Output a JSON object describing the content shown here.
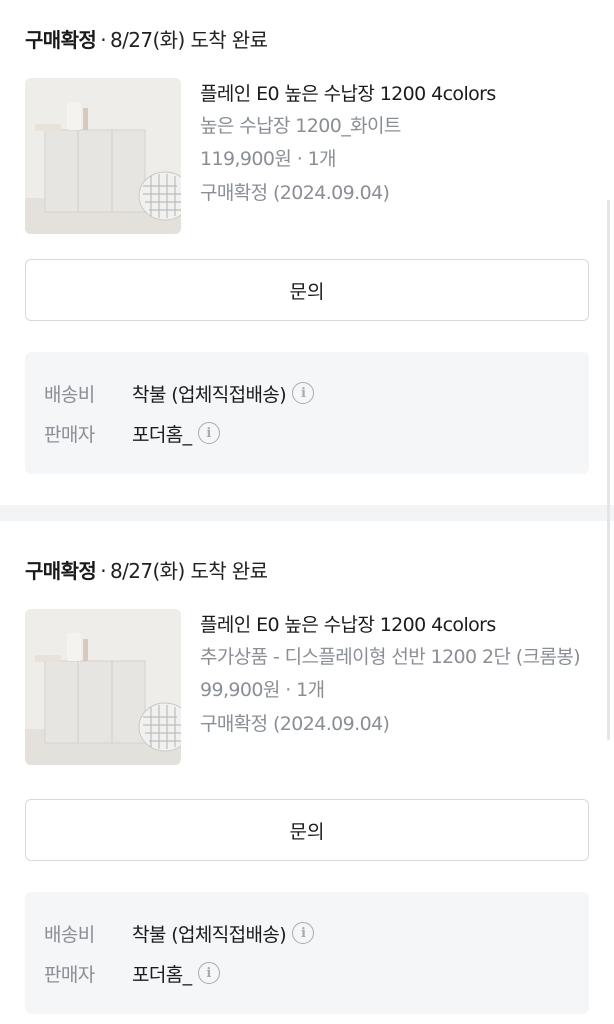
{
  "orders": [
    {
      "status": "구매확정",
      "separator": "·",
      "date_text": "8/27(화) 도착 완료",
      "product_name": "플레인 E0 높은 수납장 1200 4colors",
      "option": "높은 수납장 1200_화이트",
      "price_qty": "119,900원 · 1개",
      "confirm_date": "구매확정 (2024.09.04)",
      "inquiry_label": "문의",
      "delivery_fee_label": "배송비",
      "delivery_fee_value": "착불 (업체직접배송)",
      "seller_label": "판매자",
      "seller_value": "포더홈_"
    },
    {
      "status": "구매확정",
      "separator": "·",
      "date_text": "8/27(화) 도착 완료",
      "product_name": "플레인 E0 높은 수납장 1200 4colors",
      "option": "추가상품 - 디스플레이형 선반 1200 2단 (크롬봉)",
      "price_qty": "99,900원 · 1개",
      "confirm_date": "구매확정 (2024.09.04)",
      "inquiry_label": "문의",
      "delivery_fee_label": "배송비",
      "delivery_fee_value": "착불 (업체직접배송)",
      "seller_label": "판매자",
      "seller_value": "포더홈_"
    }
  ],
  "icons": {
    "info": "info-circle-icon",
    "info_glyph": "i"
  },
  "colors": {
    "text_primary": "#1c1c1c",
    "text_secondary": "#8a8f96",
    "panel_bg": "#f5f6f8",
    "border": "#d7d9dc"
  }
}
